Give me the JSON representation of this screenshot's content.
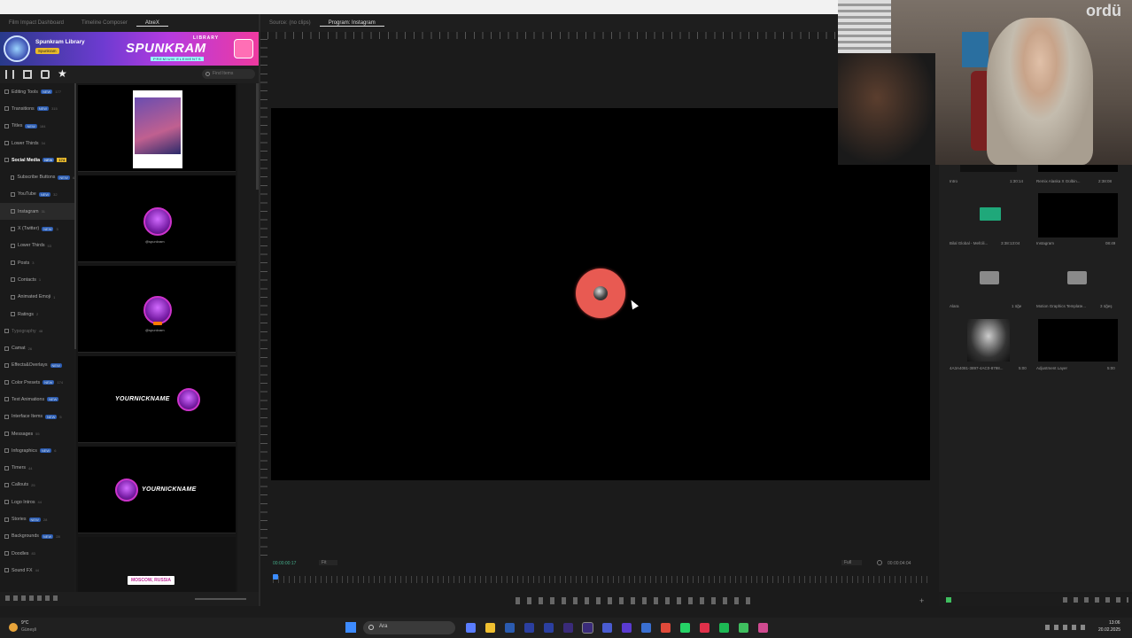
{
  "panel_tabs": {
    "left": [
      "Film Impact Dashboard",
      "Timeline Composer",
      "AtxeX"
    ],
    "monitor": [
      "Source: (no clips)",
      "Program: Instagram"
    ]
  },
  "plugin": {
    "name": "Spunkram Library",
    "user_badge": "Spunkram",
    "logo_top": "LIBRARY",
    "logo_main": "SPUNKRAM",
    "logo_sub": "PREMIUM ELEMENTS",
    "search_placeholder": "Find Items"
  },
  "sidebar": {
    "items": [
      {
        "label": "Editing Tools",
        "badge": "NEW",
        "count": "177"
      },
      {
        "label": "Transitions",
        "badge": "NEW",
        "count": "315"
      },
      {
        "label": "Titles",
        "badge": "NEW",
        "count": "184"
      },
      {
        "label": "Lower Thirds",
        "badge": "",
        "count": "34"
      },
      {
        "label": "Social Media",
        "badge": "NEW",
        "count": "174",
        "active": true
      },
      {
        "label": "Subscribe Buttons",
        "badge": "NEW",
        "count": "4",
        "indent": true
      },
      {
        "label": "YouTube",
        "badge": "NEW",
        "count": "32",
        "indent": true
      },
      {
        "label": "Instagram",
        "badge": "",
        "count": "31",
        "indent": true,
        "selected": true
      },
      {
        "label": "X (Twitter)",
        "badge": "NEW",
        "count": "3",
        "indent": true
      },
      {
        "label": "Lower Thirds",
        "badge": "",
        "count": "53",
        "indent": true
      },
      {
        "label": "Posts",
        "badge": "",
        "count": "3",
        "indent": true
      },
      {
        "label": "Contacts",
        "badge": "",
        "count": "1",
        "indent": true
      },
      {
        "label": "Animated Emoji",
        "badge": "",
        "count": "1",
        "indent": true
      },
      {
        "label": "Ratings",
        "badge": "",
        "count": "2",
        "indent": true
      },
      {
        "label": "Typography",
        "badge": "",
        "count": "48",
        "dim": true
      },
      {
        "label": "Camat",
        "badge": "",
        "count": "26"
      },
      {
        "label": "Effects&Overlays",
        "badge": "NEW",
        "count": ""
      },
      {
        "label": "Color Presets",
        "badge": "NEW",
        "count": "174"
      },
      {
        "label": "Text Animations",
        "badge": "NEW",
        "count": ""
      },
      {
        "label": "Interface Items",
        "badge": "NEW",
        "count": "5"
      },
      {
        "label": "Messages",
        "badge": "",
        "count": "55"
      },
      {
        "label": "Infographics",
        "badge": "NEW",
        "count": "6"
      },
      {
        "label": "Timers",
        "badge": "",
        "count": "44"
      },
      {
        "label": "Callouts",
        "badge": "",
        "count": "25"
      },
      {
        "label": "Logo Intros",
        "badge": "",
        "count": "44"
      },
      {
        "label": "Stories",
        "badge": "NEW",
        "count": "28"
      },
      {
        "label": "Backgrounds",
        "badge": "NEW",
        "count": "28"
      },
      {
        "label": "Doodles",
        "badge": "",
        "count": "83"
      },
      {
        "label": "Sound FX",
        "badge": "",
        "count": "44"
      }
    ]
  },
  "cards": [
    {
      "type": "post"
    },
    {
      "type": "avatar",
      "caption": "@spunkram"
    },
    {
      "type": "avatar",
      "caption": "@spunkram"
    },
    {
      "type": "nick-right",
      "text": "YOURNICKNAME"
    },
    {
      "type": "nick-left",
      "text": "YOURNICKNAME"
    },
    {
      "type": "tag",
      "text": "MOSCOW, RUSSIA"
    }
  ],
  "monitor": {
    "timecode_left": "00:00:00:17",
    "fit": "Fit",
    "quality": "Full",
    "timecode_right": "00:00:04:04"
  },
  "project_items": [
    {
      "label": "Intro",
      "meta": "1:30:14"
    },
    {
      "label": "Remix Alaska X Gülbin...",
      "meta": "2:38:08"
    },
    {
      "label": "Bilal Global - Mefcili...",
      "meta": "3:38:13:04"
    },
    {
      "label": "Instagram",
      "meta": "08:49"
    },
    {
      "label": "Alara",
      "meta": "1 öğe"
    },
    {
      "label": "Motion Graphics Template...",
      "meta": "3 öğeş"
    },
    {
      "label": "4A3A4081-3897-4AC0-8798...",
      "meta": "5:00"
    },
    {
      "label": "Adjustment Layer",
      "meta": "5:00"
    }
  ],
  "taskbar": {
    "weather_temp": "9°C",
    "weather_desc": "Güneşli",
    "search_label": "Ara",
    "time": "13:06",
    "date": "20.02.2025"
  },
  "colors": {
    "record": "#e85a52",
    "accent_purple": "#b53be0",
    "badge_blue": "#2b5bb0"
  }
}
